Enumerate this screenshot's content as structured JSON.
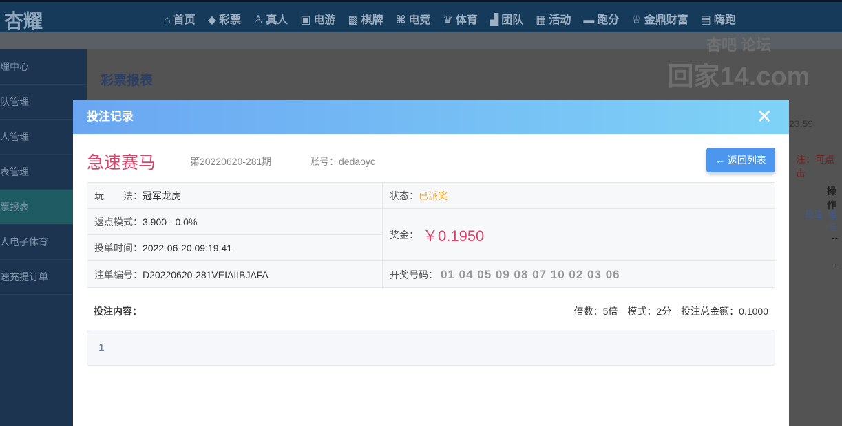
{
  "header": {
    "logo": "杏耀",
    "nav": [
      {
        "icon": "home-icon",
        "g": "⌂",
        "label": "首页"
      },
      {
        "icon": "lottery-icon",
        "g": "◆",
        "label": "彩票"
      },
      {
        "icon": "live-icon",
        "g": "♙",
        "label": "真人"
      },
      {
        "icon": "slot-icon",
        "g": "▣",
        "label": "电游"
      },
      {
        "icon": "cards-icon",
        "g": "▩",
        "label": "棋牌"
      },
      {
        "icon": "gamepad-icon",
        "g": "⌘",
        "label": "电竞"
      },
      {
        "icon": "trophy-icon",
        "g": "♛",
        "label": "体育"
      },
      {
        "icon": "team-icon",
        "g": "▟",
        "label": "团队"
      },
      {
        "icon": "gift-icon",
        "g": "▦",
        "label": "活动"
      },
      {
        "icon": "car-icon",
        "g": "▬",
        "label": "跑分"
      },
      {
        "icon": "coin-icon",
        "g": "♕",
        "label": "金鼎财富"
      },
      {
        "icon": "hi-icon",
        "g": "▤",
        "label": "嗨跑"
      }
    ]
  },
  "sidebar": [
    "理中心",
    "队管理",
    "人管理",
    "表管理",
    "票报表",
    "人电子体育",
    "速充提订单"
  ],
  "page": {
    "title": "彩票报表",
    "time_fragment": "23:59",
    "note": "注：可点击",
    "op_header": "操作",
    "link_bet": "投注",
    "link_trace": "追号",
    "dash": "--"
  },
  "watermark": {
    "top": "杏吧 论坛",
    "main": "回家14.com"
  },
  "modal": {
    "title": "投注记录",
    "close": "✕",
    "game": "急速赛马",
    "issue": "第20220620-281期",
    "account": "账号：dedaoyc",
    "back": "← 返回列表",
    "play_label": "玩　　法：",
    "play": "冠军龙虎",
    "status_label": "状态：",
    "status": "已派奖",
    "rebate_label": "返点模式：",
    "rebate": "3.900 - 0.0%",
    "time_label": "投单时间：",
    "time": "2022-06-20 09:19:41",
    "prize_label": "奖金：",
    "prize": "￥0.1950",
    "order_label": "注单编号：",
    "order": "D20220620-281VEIAIIBJAFA",
    "draw_label": "开奖号码：",
    "draw": "01 04 05 09 08 07 10 02 03 06",
    "content_label": "投注内容：",
    "meta": "倍数：5倍　模式：2分　投注总金额：0.1000",
    "content": "1"
  }
}
